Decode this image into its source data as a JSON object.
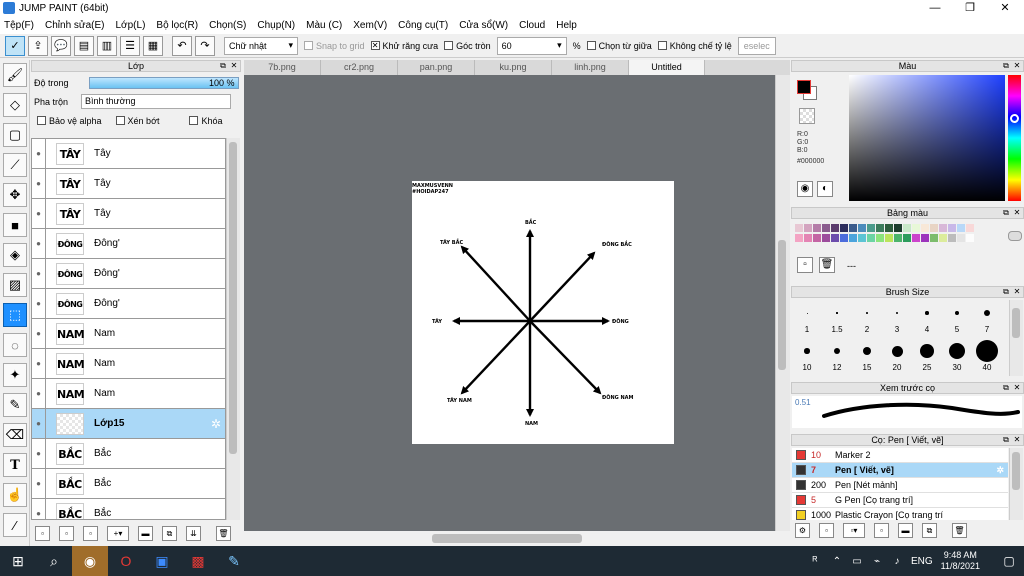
{
  "window": {
    "title": "JUMP PAINT (64bit)",
    "minimize": "—",
    "maximize": "❐",
    "close": "✕"
  },
  "menu": [
    "Tệp(F)",
    "Chỉnh sửa(E)",
    "Lớp(L)",
    "Bộ lọc(R)",
    "Chọn(S)",
    "Chụp(N)",
    "Màu (C)",
    "Xem(V)",
    "Công cụ(T)",
    "Cửa sổ(W)",
    "Cloud",
    "Help"
  ],
  "toolbar": {
    "shape_select": "Chữ nhật",
    "snap_grid": "Snap to grid",
    "antialias": "Khử răng cưa",
    "round_corner": "Góc tròn",
    "round_value": "60",
    "percent": "%",
    "select_center": "Chọn từ giữa",
    "no_ratio": "Không chế tỷ lệ",
    "deselect": "eselec"
  },
  "layer_panel": {
    "title": "Lớp",
    "opacity_label": "Độ trong",
    "opacity_value": "100 %",
    "blend_label": "Pha trộn",
    "blend_value": "Bình thường",
    "protect_alpha": "Bảo vệ alpha",
    "clip": "Xén bớt",
    "lock": "Khóa",
    "layers": [
      {
        "thumb": "TÂY",
        "name": "Tây"
      },
      {
        "thumb": "TÂY",
        "name": "Tây"
      },
      {
        "thumb": "TÂY",
        "name": "Tây"
      },
      {
        "thumb": "ĐÔNG",
        "name": "Đông'"
      },
      {
        "thumb": "ĐÔNG",
        "name": "Đông'"
      },
      {
        "thumb": "ĐÔNG",
        "name": "Đông'"
      },
      {
        "thumb": "NAM",
        "name": "Nam"
      },
      {
        "thumb": "NAM",
        "name": "Nam"
      },
      {
        "thumb": "NAM",
        "name": "Nam"
      },
      {
        "thumb": "",
        "name": "Lớp15"
      },
      {
        "thumb": "BẮC",
        "name": "Bắc"
      },
      {
        "thumb": "BẮC",
        "name": "Bắc"
      },
      {
        "thumb": "BẮC",
        "name": "Bắc"
      }
    ]
  },
  "tabs": [
    "7b.png",
    "cr2.png",
    "pan.png",
    "ku.png",
    "linh.png",
    "Untitled"
  ],
  "canvas": {
    "watermark_line1": "MAXMUSVENN",
    "watermark_line2": "#HOIDAP247",
    "north": "BẮC",
    "south": "NAM",
    "east": "ĐÔNG",
    "west": "TÂY",
    "northeast": "ĐÔNG BẮC",
    "northwest": "TÂY BẮC",
    "southeast": "ĐÔNG NAM",
    "southwest": "TÂY NAM"
  },
  "color_panel": {
    "title": "Màu",
    "r": "R:0",
    "g": "G:0",
    "b": "B:0",
    "hex": "#000000"
  },
  "palette_panel": {
    "title": "Bảng màu",
    "dash": "---"
  },
  "brush_size": {
    "title": "Brush Size",
    "sizes": [
      "1",
      "1.5",
      "2",
      "3",
      "4",
      "5",
      "7",
      "10",
      "12",
      "15",
      "20",
      "25",
      "30",
      "40"
    ]
  },
  "preview": {
    "title": "Xem trước cọ",
    "value": "0.51"
  },
  "brush_panel": {
    "title": "Cọ: Pen [ Viết, vẽ]",
    "items": [
      {
        "size": "10",
        "name": "Marker 2",
        "color": "#e53935"
      },
      {
        "size": "7",
        "name": "Pen [ Viết, vẽ]",
        "color": "#333333"
      },
      {
        "size": "200",
        "name": "Pen [Nét mảnh]",
        "color": "#333333"
      },
      {
        "size": "5",
        "name": "G Pen [Cọ trang trí]",
        "color": "#e53935"
      },
      {
        "size": "1000",
        "name": "Plastic Crayon [Cọ trang trí",
        "color": "#f2d024"
      }
    ]
  },
  "taskbar": {
    "time": "9:48 AM",
    "date": "11/8/2021",
    "lang": "ENG"
  }
}
